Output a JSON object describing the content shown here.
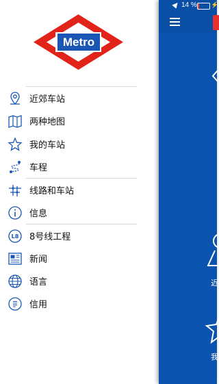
{
  "brand": {
    "logo_text": "Metro",
    "red": "#e2231a",
    "blue": "#1a57b4"
  },
  "menu": [
    {
      "label": "近郊车站",
      "icon": "location-pin-icon"
    },
    {
      "label": "两种地图",
      "icon": "map-icon"
    },
    {
      "label": "我的车站",
      "icon": "star-icon"
    },
    {
      "label": "车程",
      "icon": "route-icon"
    },
    {
      "label": "线路和车站",
      "icon": "lines-stations-icon"
    },
    {
      "label": "信息",
      "icon": "info-icon"
    },
    {
      "label": "8号线工程",
      "icon": "l8-badge-icon"
    },
    {
      "label": "新闻",
      "icon": "newspaper-icon"
    },
    {
      "label": "语言",
      "icon": "globe-icon"
    },
    {
      "label": "信用",
      "icon": "credits-icon"
    }
  ],
  "status_bar": {
    "battery_percent": "14 %",
    "battery_level": 0.14
  },
  "main_panel": {
    "label_1": "近",
    "label_2": "我",
    "colors": {
      "background": "#0a54b0",
      "accent": "#e8312f"
    }
  }
}
